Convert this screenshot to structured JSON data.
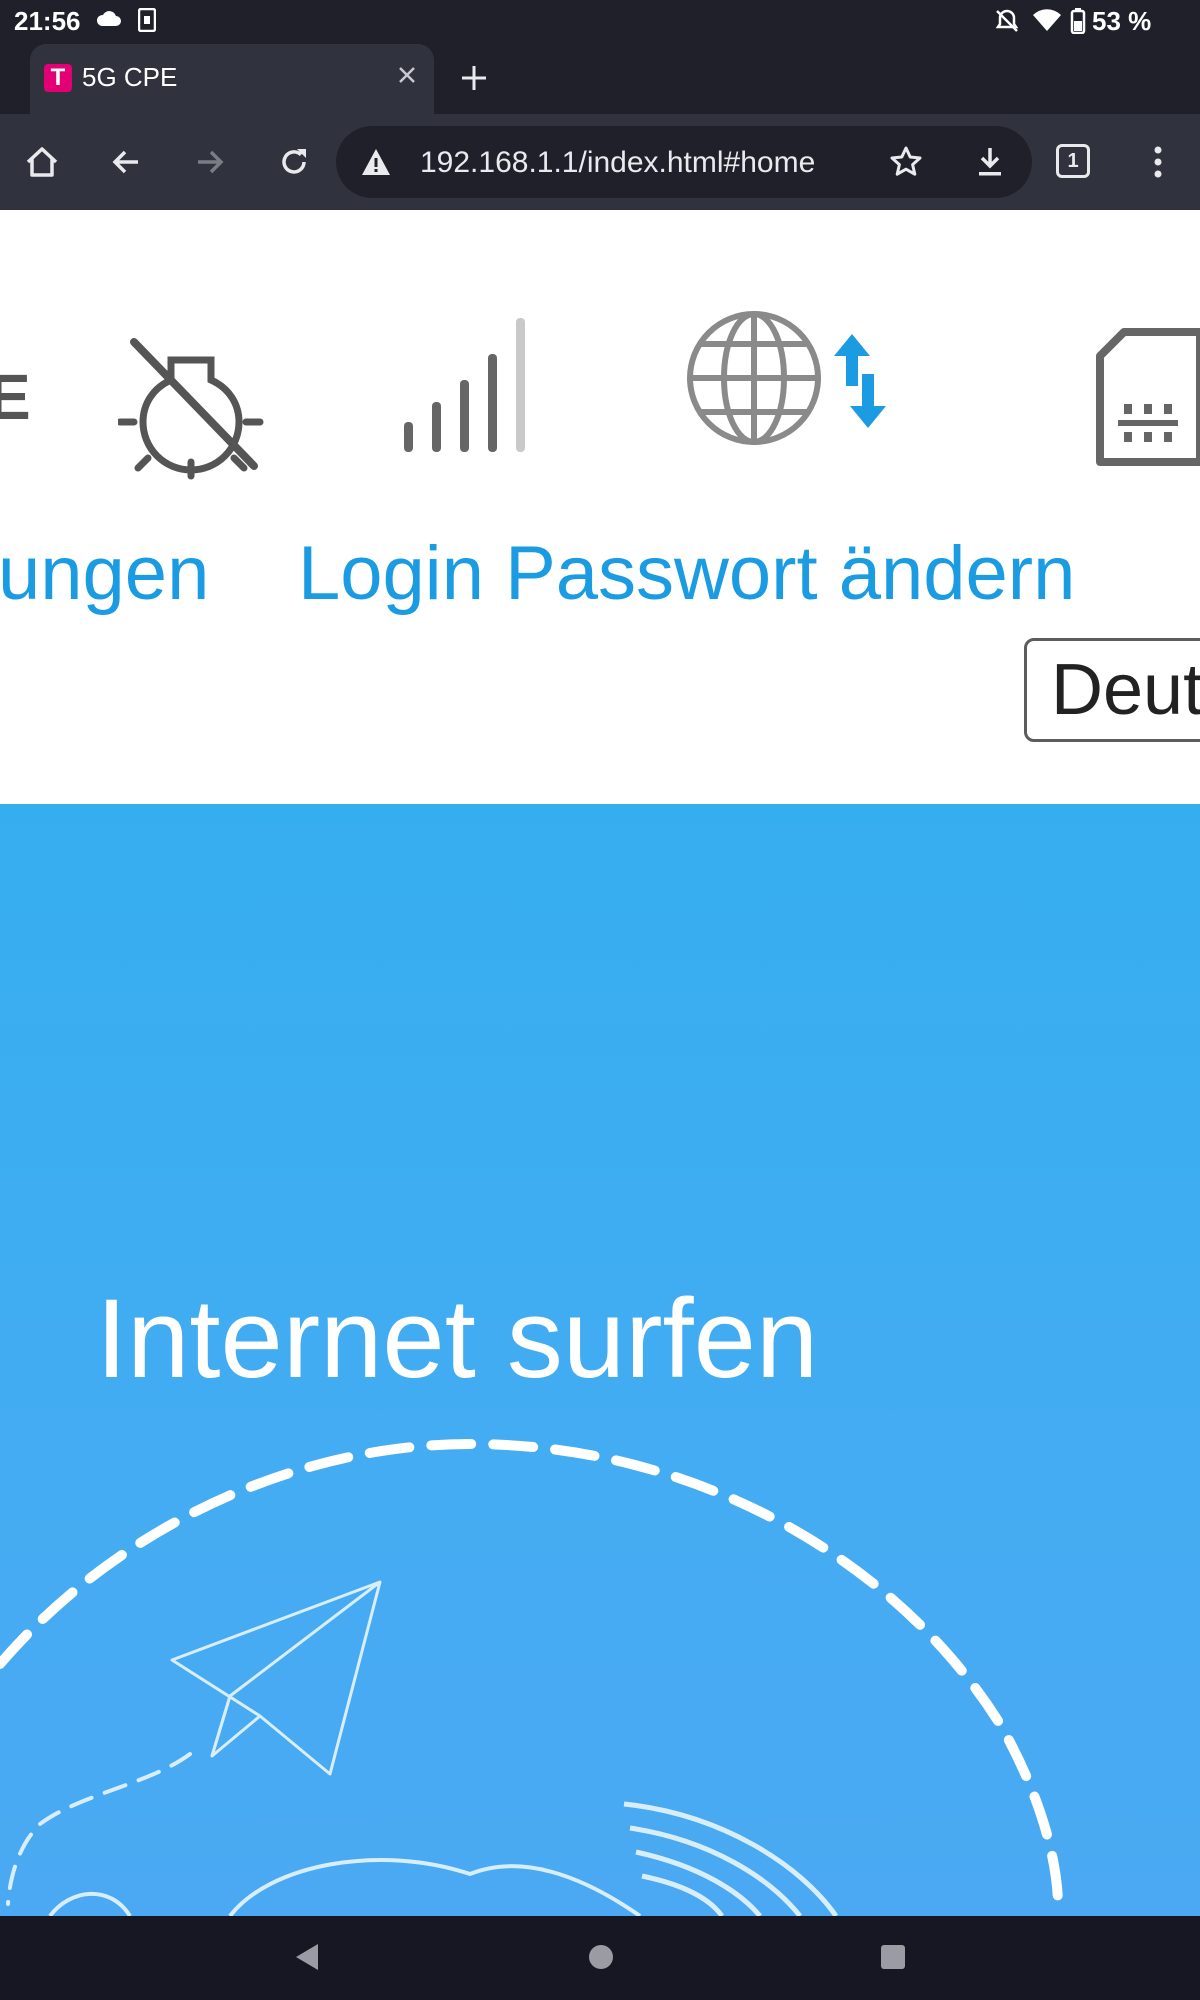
{
  "status_bar": {
    "time": "21:56",
    "battery": "53 %",
    "icons": [
      "cloud-icon",
      "sim-icon",
      "mute-icon",
      "wifi-icon",
      "battery-icon"
    ]
  },
  "browser": {
    "tab_title": "5G CPE",
    "tab_count": "1",
    "url": "192.168.1.1/index.html#home"
  },
  "header": {
    "brand_fragment": "E",
    "nav_links": [
      {
        "label": "ungen"
      },
      {
        "label": "Login Passwort ändern"
      }
    ],
    "language_select": {
      "selected": "Deutsch"
    },
    "icons": [
      "lamp-off-icon",
      "signal-strength-icon",
      "globe-data-icon",
      "sim-card-icon"
    ],
    "accent": "#1b9be1"
  },
  "hero": {
    "title": "Internet surfen",
    "background": "#3aaef0"
  }
}
